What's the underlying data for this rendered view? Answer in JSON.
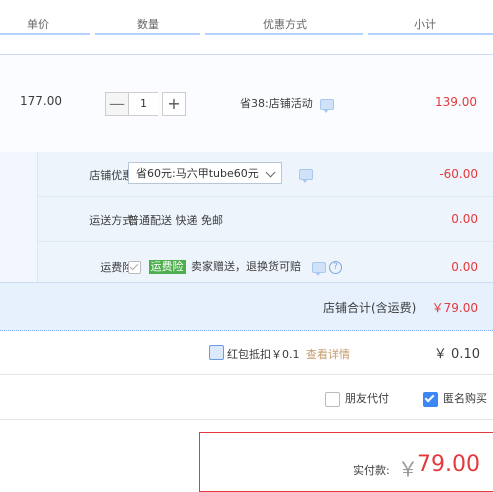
{
  "header": {
    "col_price": "单价",
    "col_qty": "数量",
    "col_discount": "优惠方式",
    "col_subtotal": "小计"
  },
  "item": {
    "price": "177.00",
    "qty": "1",
    "minus": "—",
    "plus": "+",
    "promo": "省38:店铺活动",
    "subtotal": "139.00"
  },
  "shop": {
    "coupon_label": "店铺优惠:",
    "coupon_value": "省60元:马六甲tube60元",
    "coupon_amount": "-60.00",
    "ship_label": "运送方式:",
    "ship_value": "普通配送 快递 免邮",
    "ship_amount": "0.00",
    "ins_label": "运费险:",
    "ins_tag": "运费险",
    "ins_value": "卖家赠送，退换货可赔",
    "ins_amount": "0.00",
    "help_glyph": "?"
  },
  "shop_total": {
    "label": "店铺合计(含运费)",
    "amount": "￥79.00"
  },
  "red_packet": {
    "label": "红包抵扣￥0.1",
    "link": "查看详情",
    "value": "￥ 0.10"
  },
  "options": {
    "friend_pay": "朋友代付",
    "anonymous": "匿名购买"
  },
  "payment": {
    "label": "实付款:",
    "currency": "￥",
    "amount": "79.00"
  },
  "colors": {
    "accent_red": "#e4393c",
    "link_brown": "#c49a6c",
    "checkbox_blue": "#3a87f5",
    "tag_green": "#4cae4c"
  }
}
